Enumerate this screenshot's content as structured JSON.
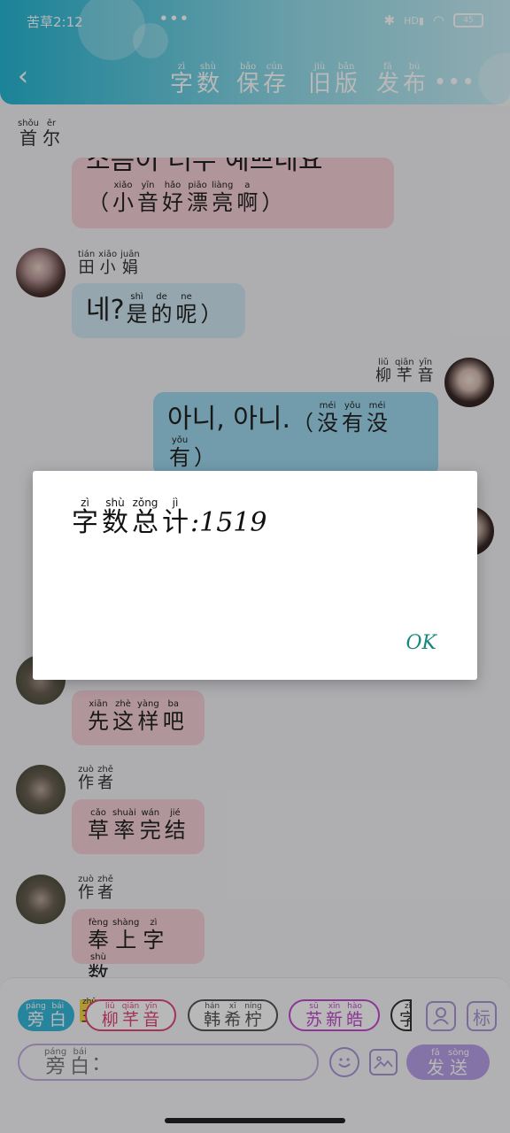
{
  "status_bar": {
    "time": "苦草2:12",
    "dots": "•••",
    "network": "HD",
    "battery": "45"
  },
  "header": {
    "menu": [
      {
        "chars": [
          {
            "py": "zì",
            "ch": "字"
          },
          {
            "py": "shù",
            "ch": "数"
          }
        ]
      },
      {
        "chars": [
          {
            "py": "bǎo",
            "ch": "保"
          },
          {
            "py": "cún",
            "ch": "存"
          }
        ]
      },
      {
        "chars": [
          {
            "py": "jiù",
            "ch": "旧"
          },
          {
            "py": "bǎn",
            "ch": "版"
          }
        ]
      },
      {
        "chars": [
          {
            "py": "fā",
            "ch": "发"
          },
          {
            "py": "bù",
            "ch": "布"
          }
        ]
      }
    ],
    "more": "•••"
  },
  "section_label": [
    {
      "py": "shǒu",
      "ch": "首"
    },
    {
      "py": "ěr",
      "ch": "尔"
    }
  ],
  "messages": {
    "m1": {
      "korean": "소음이 너무 예쁘네요",
      "chars": [
        {
          "py": "",
          "ch": "（"
        },
        {
          "py": "xiǎo",
          "ch": "小"
        },
        {
          "py": "yīn",
          "ch": "音"
        },
        {
          "py": "hǎo",
          "ch": "好"
        },
        {
          "py": "piāo",
          "ch": "漂"
        },
        {
          "py": "liàng",
          "ch": "亮"
        },
        {
          "py": "a",
          "ch": "啊"
        },
        {
          "py": "",
          "ch": "）"
        }
      ]
    },
    "m2": {
      "name": [
        {
          "py": "tián",
          "ch": "田"
        },
        {
          "py": "xiǎo",
          "ch": "小"
        },
        {
          "py": "juān",
          "ch": "娟"
        }
      ],
      "korean": "네?",
      "chars": [
        {
          "py": "shì",
          "ch": "是"
        },
        {
          "py": "de",
          "ch": "的"
        },
        {
          "py": "ne",
          "ch": "呢"
        },
        {
          "py": "",
          "ch": "）"
        }
      ]
    },
    "m3": {
      "name": [
        {
          "py": "liǔ",
          "ch": "柳"
        },
        {
          "py": "qiān",
          "ch": "芊"
        },
        {
          "py": "yīn",
          "ch": "音"
        }
      ],
      "korean": "아니, 아니.",
      "chars1": [
        {
          "py": "",
          "ch": "（"
        },
        {
          "py": "méi",
          "ch": "没"
        },
        {
          "py": "yǒu",
          "ch": "有"
        },
        {
          "py": "méi",
          "ch": "没"
        }
      ],
      "chars2": [
        {
          "py": "yǒu",
          "ch": "有"
        },
        {
          "py": "",
          "ch": "）"
        }
      ]
    },
    "m4": {
      "chars": [
        {
          "py": "xiān",
          "ch": "先"
        },
        {
          "py": "zhè",
          "ch": "这"
        },
        {
          "py": "yàng",
          "ch": "样"
        },
        {
          "py": "ba",
          "ch": "吧"
        }
      ]
    },
    "m5": {
      "name": [
        {
          "py": "zuò",
          "ch": "作"
        },
        {
          "py": "zhě",
          "ch": "者"
        }
      ],
      "chars": [
        {
          "py": "cǎo",
          "ch": "草"
        },
        {
          "py": "shuài",
          "ch": "率"
        },
        {
          "py": "wán",
          "ch": "完"
        },
        {
          "py": "jié",
          "ch": "结"
        }
      ]
    },
    "m6": {
      "name": [
        {
          "py": "zuò",
          "ch": "作"
        },
        {
          "py": "zhě",
          "ch": "者"
        }
      ],
      "chars": [
        {
          "py": "fèng",
          "ch": "奉"
        },
        {
          "py": "shàng",
          "ch": "上"
        },
        {
          "py": "zì",
          "ch": "字"
        },
        {
          "py": "shù",
          "ch": "数"
        }
      ]
    }
  },
  "dialog": {
    "title": [
      {
        "py": "zì",
        "ch": "字"
      },
      {
        "py": "shù",
        "ch": "数"
      },
      {
        "py": "zǒng",
        "ch": "总"
      },
      {
        "py": "jì",
        "ch": "计"
      }
    ],
    "colon": ":",
    "count": "1519",
    "ok": "OK"
  },
  "bottom_bar": {
    "chips": [
      {
        "chars": [
          {
            "py": "páng",
            "ch": "旁"
          },
          {
            "py": "bái",
            "ch": "白"
          }
        ],
        "color": "#35b8d8"
      },
      {
        "chars": [
          {
            "py": "zhǔ",
            "ch": "主"
          }
        ],
        "color": "#f2d54a"
      },
      {
        "chars": [
          {
            "py": "liǔ",
            "ch": "柳"
          },
          {
            "py": "qiān",
            "ch": "芊"
          },
          {
            "py": "yīn",
            "ch": "音"
          }
        ],
        "color": "#e0467a"
      },
      {
        "chars": [
          {
            "py": "hán",
            "ch": "韩"
          },
          {
            "py": "xī",
            "ch": "希"
          },
          {
            "py": "níng",
            "ch": "柠"
          }
        ],
        "color": "#555555"
      },
      {
        "chars": [
          {
            "py": "sū",
            "ch": "苏"
          },
          {
            "py": "xīn",
            "ch": "新"
          },
          {
            "py": "hào",
            "ch": "皓"
          }
        ],
        "color": "#c24ad0"
      },
      {
        "chars": [
          {
            "py": "zì",
            "ch": "字"
          }
        ],
        "color": "#333333"
      }
    ],
    "icons": [
      "person-icon",
      "tag-icon"
    ],
    "tag_label": "标",
    "input_label": [
      {
        "py": "páng",
        "ch": "旁"
      },
      {
        "py": "bái",
        "ch": "白"
      }
    ],
    "input_colon": "：",
    "send": [
      {
        "py": "fā",
        "ch": "发"
      },
      {
        "py": "sòng",
        "ch": "送"
      }
    ]
  }
}
